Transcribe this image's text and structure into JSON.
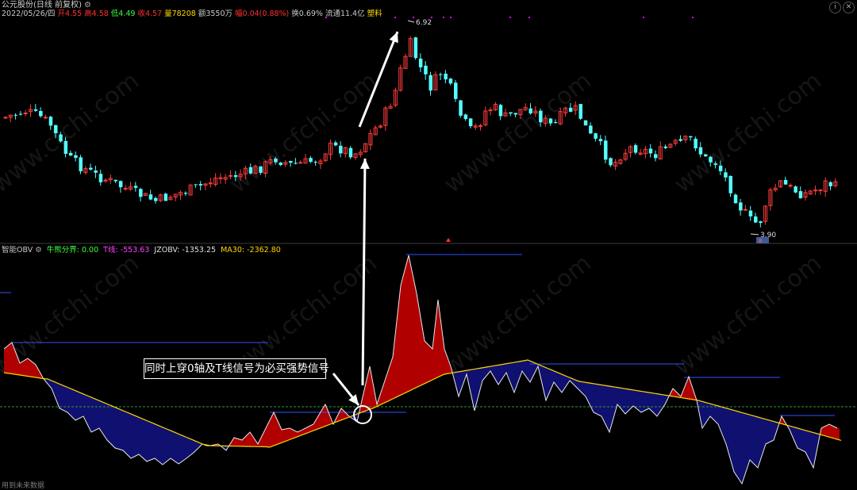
{
  "header": {
    "title": "公元股份(日线 前复权)",
    "date": "2022/05/26/四",
    "open": "开4.55",
    "high": "高4.58",
    "low": "低4.49",
    "close": "收4.57",
    "volume": "量78208",
    "amount": "额3550万",
    "change": "幅0.04(0.88%)",
    "turnover": "换0.69%",
    "float_cap": "流通11.4亿",
    "sector": "塑料"
  },
  "price_panel": {
    "high_label": "6.92",
    "low_label": "3.90",
    "low_tag": "B"
  },
  "indicator": {
    "name": "智能OBV",
    "strong_line": "牛熊分界: 0.00",
    "t_line": "T线: -553.63",
    "jzobv": "JZOBV: -1353.25",
    "ma30": "MA30: -2362.80"
  },
  "callout_text": "同时上穿0轴及T线信号为必买强势信号",
  "footer_text": "用到未来数据",
  "watermark": "www.cfchi.com",
  "window_buttons": [
    "info-icon",
    "close-icon"
  ],
  "colors": {
    "up": "#ff3c3c",
    "down": "#54ffff",
    "fill_up": "#b00000",
    "fill_down": "#101070",
    "ma_line": "#ffd700",
    "zero_line": "#2e9e2e",
    "t_lines": "#3050ff",
    "text_label": "#c8c8c8",
    "change_red": "#ff3030",
    "low_green": "#3cff3c",
    "purple": "#ff00ff"
  }
}
